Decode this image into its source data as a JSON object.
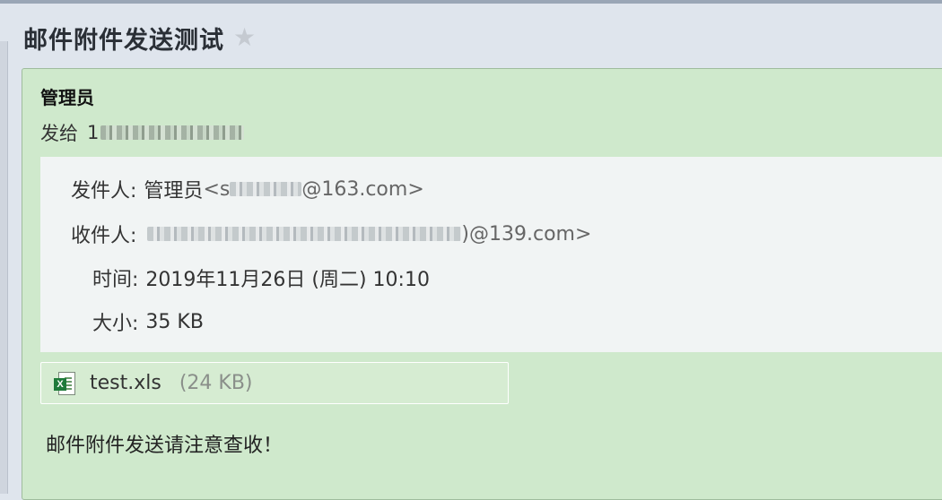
{
  "subject": "邮件附件发送测试",
  "sender": {
    "name": "管理员",
    "sent_to_prefix": "发给",
    "sent_to_visible": "1"
  },
  "headers": {
    "from_label": "发件人:",
    "from_name": "管理员",
    "from_open": "<s",
    "from_domain": "@163.com>",
    "to_label": "收件人:",
    "to_domain": ")@139.com>",
    "time_label": "时间:",
    "time_value": "2019年11月26日 (周二) 10:10",
    "size_label": "大小:",
    "size_value": "35 KB"
  },
  "attachment": {
    "filename": "test.xls",
    "size": "(24 KB)",
    "icon": "excel-file-icon"
  },
  "body": "邮件附件发送请注意查收！",
  "icons": {
    "star": "star-icon"
  }
}
